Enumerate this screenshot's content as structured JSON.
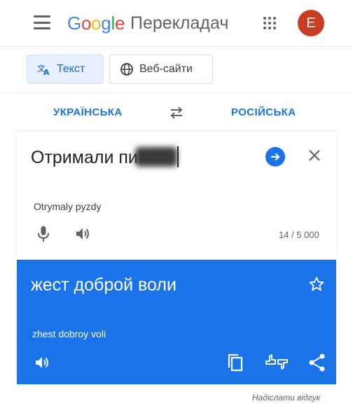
{
  "header": {
    "logo_letters": [
      "G",
      "o",
      "o",
      "g",
      "l",
      "e"
    ],
    "product_name": "Перекладач",
    "avatar_letter": "E",
    "avatar_color": "#c93d22"
  },
  "tabs": [
    {
      "label": "Текст",
      "icon": "translate-icon",
      "selected": true
    },
    {
      "label": "Веб-сайти",
      "icon": "globe-icon",
      "selected": false
    }
  ],
  "languages": {
    "source": "УКРАЇНСЬКА",
    "target": "РОСІЙСЬКА",
    "swap_icon": "swap-icon"
  },
  "input": {
    "text_visible": "Отримали пи",
    "transliteration": "Otrymaly pyzdy",
    "char_count": "14 / 5 000",
    "icons": [
      "microphone-icon",
      "speaker-icon",
      "arrow-forward-icon",
      "close-icon"
    ]
  },
  "output": {
    "text": "жест доброй воли",
    "transliteration": "zhest dobroy voli",
    "background_color": "#1a73e8",
    "icons": [
      "star-icon",
      "speaker-icon",
      "copy-icon",
      "rate-icon",
      "share-icon"
    ]
  },
  "footer": {
    "feedback_label": "Надіслати відгук"
  },
  "colors": {
    "accent": "#1a73e8",
    "selected_tab_bg": "#e8f0fe"
  }
}
